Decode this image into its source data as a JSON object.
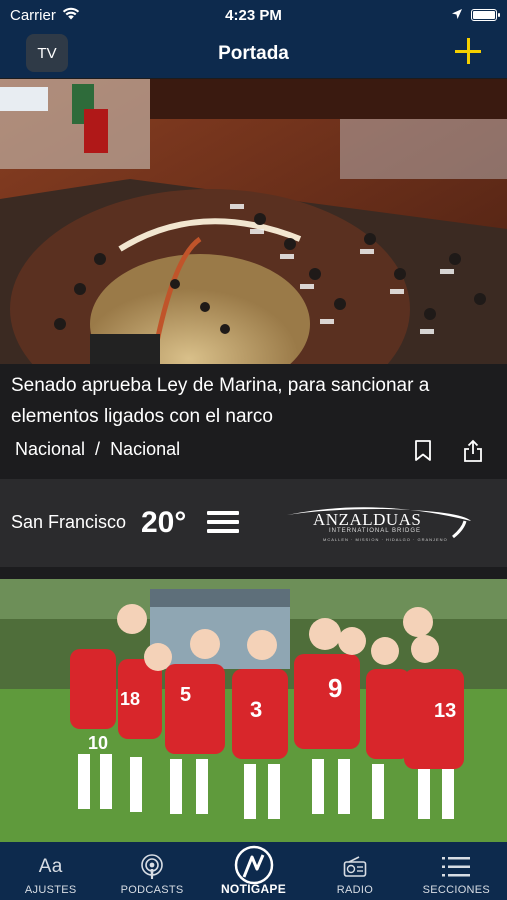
{
  "status": {
    "carrier": "Carrier",
    "time": "4:23 PM"
  },
  "nav": {
    "title": "Portada",
    "tv_label": "TV"
  },
  "article1": {
    "headline": "Senado aprueba Ley de Marina, para sancionar a elementos ligados con el narco",
    "category": "Nacional",
    "separator": "/",
    "subcategory": "Nacional"
  },
  "weather": {
    "city": "San Francisco",
    "temperature": "20°"
  },
  "ad": {
    "brand": "ANZALDUAS",
    "tagline": "INTERNATIONAL BRIDGE",
    "cities": "MCALLEN · MISSION · HIDALGO · GRANJENO"
  },
  "tabs": [
    {
      "label": "AJUSTES",
      "icon": "text-size-icon"
    },
    {
      "label": "PODCASTS",
      "icon": "podcast-icon"
    },
    {
      "label": "NOTIGAPE",
      "icon": "notigape-logo-icon"
    },
    {
      "label": "RADIO",
      "icon": "radio-icon"
    },
    {
      "label": "SECCIONES",
      "icon": "sections-list-icon"
    }
  ],
  "colors": {
    "navy": "#0d2a4d",
    "accent_yellow": "#f5d000",
    "strip_bg": "#2b2b2d"
  }
}
